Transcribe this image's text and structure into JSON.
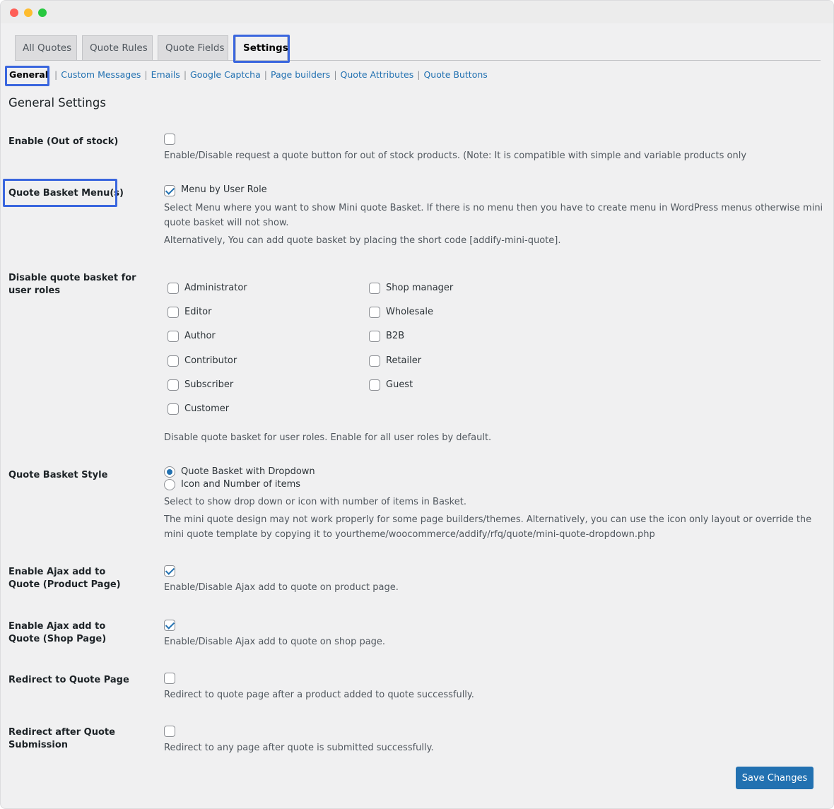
{
  "tabs": [
    "All Quotes",
    "Quote Rules",
    "Quote Fields",
    "Settings"
  ],
  "subnav": [
    "General",
    "Custom Messages",
    "Emails",
    "Google Captcha",
    "Page builders",
    "Quote Attributes",
    "Quote Buttons"
  ],
  "page_title": "General Settings",
  "fields": {
    "out_of_stock": {
      "label": "Enable (Out of stock)",
      "checked": false,
      "desc": "Enable/Disable request a quote button for out of stock products. (Note: It is compatible with simple and variable products only"
    },
    "basket_menu": {
      "label": "Quote Basket Menu(s)",
      "option": "Menu by User Role",
      "checked": true,
      "desc1": "Select Menu where you want to show Mini quote Basket. If there is no menu then you have to create menu in WordPress menus otherwise mini quote basket will not show.",
      "desc2": "Alternatively, You can add quote basket by placing the short code [addify-mini-quote]."
    },
    "roles": {
      "label": "Disable quote basket for user roles",
      "col1": [
        "Administrator",
        "Editor",
        "Author",
        "Contributor",
        "Subscriber",
        "Customer"
      ],
      "col2": [
        "Shop manager",
        "Wholesale",
        "B2B",
        "Retailer",
        "Guest"
      ],
      "desc": "Disable quote basket for user roles. Enable for all user roles by default."
    },
    "style": {
      "label": "Quote Basket Style",
      "options": [
        "Quote Basket with Dropdown",
        "Icon and Number of items"
      ],
      "selected": "Quote Basket with Dropdown",
      "desc1": "Select to show drop down or icon with number of items in Basket.",
      "desc2": "The mini quote design may not work properly for some page builders/themes. Alternatively, you can use the icon only layout or override the mini quote template by copying it to yourtheme/woocommerce/addify/rfq/quote/mini-quote-dropdown.php"
    },
    "ajax_product": {
      "label": "Enable Ajax add to Quote (Product Page)",
      "checked": true,
      "desc": "Enable/Disable Ajax add to quote on product page."
    },
    "ajax_shop": {
      "label": "Enable Ajax add to Quote (Shop Page)",
      "checked": true,
      "desc": "Enable/Disable Ajax add to quote on shop page."
    },
    "redirect_quote": {
      "label": "Redirect to Quote Page",
      "checked": false,
      "desc": "Redirect to quote page after a product added to quote successfully."
    },
    "redirect_after": {
      "label": "Redirect after Quote Submission",
      "checked": false,
      "desc": "Redirect to any page after quote is submitted successfully."
    }
  },
  "save_button": "Save Changes",
  "colors": {
    "accent": "#2271b1",
    "highlight": "#3a66de",
    "background": "#f0f0f1"
  }
}
